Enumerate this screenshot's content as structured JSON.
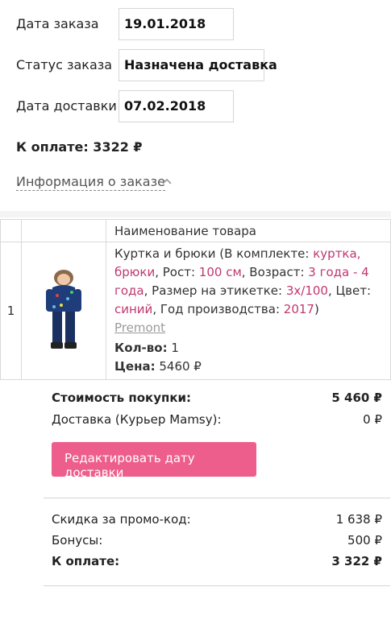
{
  "order": {
    "date_label": "Дата заказа",
    "date_value": "19.01.2018",
    "status_label": "Статус заказа",
    "status_value": "Назначена доставка",
    "delivery_label": "Дата доставки",
    "delivery_value": "07.02.2018",
    "to_pay": "К оплате: 3322 ₽",
    "info_link": "Информация о заказе"
  },
  "table": {
    "header_name": "Наименование товара",
    "rows": [
      {
        "index": "1",
        "d1": "Куртка и брюки (В комплекте: ",
        "d2": "куртка, брюки",
        "d3": ", Рост: ",
        "d4": "100 см",
        "d5": ", Возраст: ",
        "d6": "3 года - 4 года",
        "d7": ", Размер на этикетке: ",
        "d8": "3х/100",
        "d9": ", Цвет: ",
        "d10": "синий",
        "d11": ", Год производства: ",
        "d12": "2017",
        "d13": ")",
        "brand": "Premont",
        "qty_label": "Кол-во:",
        "qty_value": "1",
        "price_label": "Цена:",
        "price_value": "5460 ₽"
      }
    ]
  },
  "summary": {
    "purchase_label": "Стоимость покупки:",
    "purchase_value": "5 460 ₽",
    "delivery_label": "Доставка (Курьер Mamsy):",
    "delivery_value": "0 ₽",
    "edit_button": "Редактировать дату доставки",
    "promo_label": "Скидка за промо-код:",
    "promo_value": "1 638 ₽",
    "bonus_label": "Бонусы:",
    "bonus_value": "500 ₽",
    "total_label": "К оплате:",
    "total_value": "3 322 ₽"
  },
  "colors": {
    "accent": "#ee5e8c",
    "link_pink": "#c0376f"
  },
  "icons": {
    "info_toggle": "chevron-up-icon",
    "product_image": "kids-jacket-pants-image"
  }
}
